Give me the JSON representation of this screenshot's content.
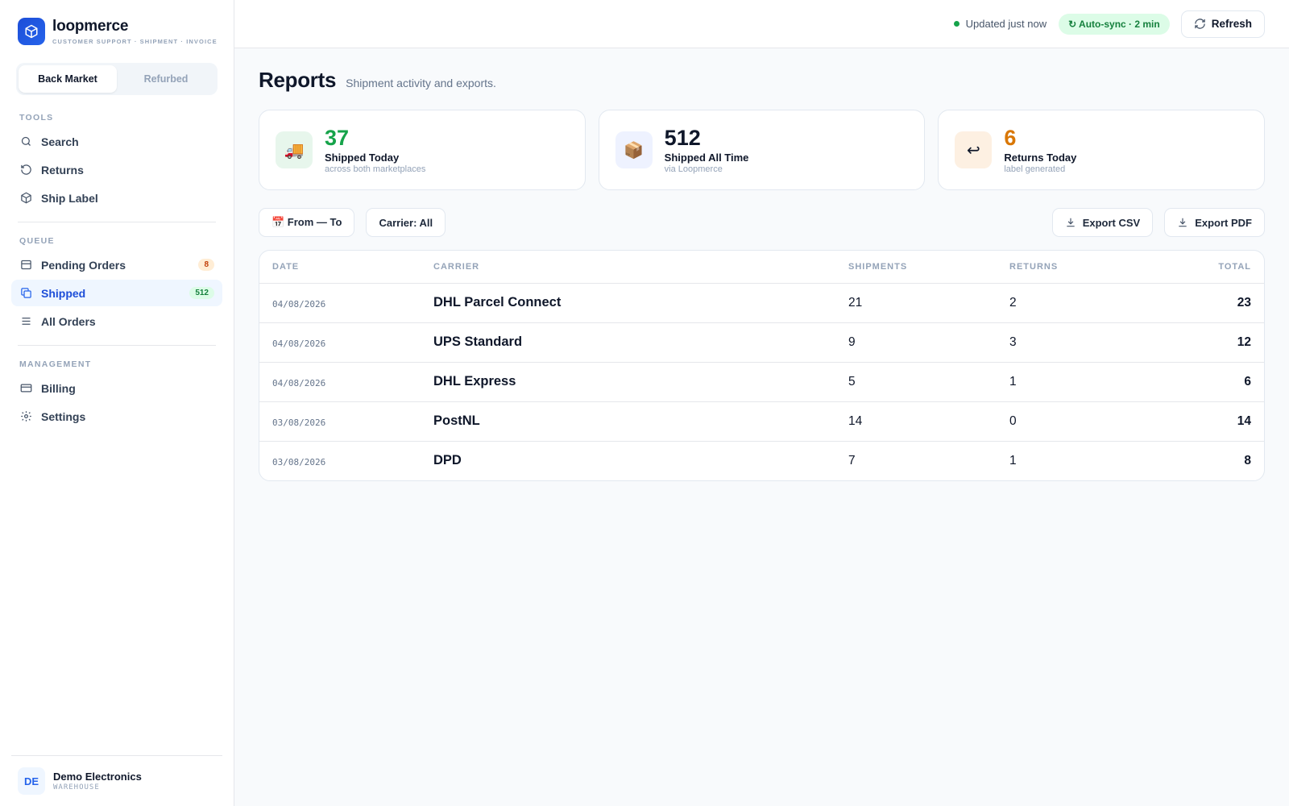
{
  "brand": {
    "name": "loopmerce",
    "tagline": "CUSTOMER SUPPORT · SHIPMENT · INVOICE"
  },
  "store_switch": {
    "options": [
      "Back Market",
      "Refurbed"
    ],
    "selected": "Back Market"
  },
  "sidebar": {
    "tools_label": "TOOLS",
    "tools": [
      {
        "label": "Search",
        "icon": "search-icon"
      },
      {
        "label": "Returns",
        "icon": "undo-icon"
      },
      {
        "label": "Ship Label",
        "icon": "box-icon"
      }
    ],
    "queue_label": "QUEUE",
    "queue": [
      {
        "label": "Pending Orders",
        "icon": "inbox-icon",
        "badge": "8"
      },
      {
        "label": "Shipped",
        "icon": "copy-icon",
        "badge": "512",
        "active": true
      },
      {
        "label": "All Orders",
        "icon": "list-icon"
      }
    ],
    "management_label": "MANAGEMENT",
    "management": [
      {
        "label": "Billing",
        "icon": "credit-card-icon"
      },
      {
        "label": "Settings",
        "icon": "gear-icon"
      }
    ]
  },
  "account": {
    "initials": "DE",
    "name": "Demo Electronics",
    "role": "WAREHOUSE"
  },
  "topbar": {
    "status_text": "Updated just now",
    "sync_label": "↻ Auto-sync · 2 min",
    "refresh_label": "Refresh",
    "colors": {
      "online": "#16a34a",
      "sync_bg": "#dcfce7"
    }
  },
  "page": {
    "title": "Reports",
    "subtitle": "Shipment activity and exports."
  },
  "stats": [
    {
      "icon": "🚚",
      "value": "37",
      "label": "Shipped Today",
      "sub": "across both marketplaces",
      "accent": "#16a34a"
    },
    {
      "icon": "📦",
      "value": "512",
      "label": "Shipped All Time",
      "sub": "via Loopmerce",
      "accent": "#0f172a"
    },
    {
      "icon": "↩",
      "value": "6",
      "label": "Returns Today",
      "sub": "label generated",
      "accent": "#d97706"
    }
  ],
  "filters": {
    "date_range": "📅 From — To",
    "carrier": "Carrier: All",
    "export_csv": "Export CSV",
    "export_pdf": "Export PDF"
  },
  "table": {
    "headers": [
      "DATE",
      "CARRIER",
      "SHIPMENTS",
      "RETURNS",
      "TOTAL"
    ],
    "rows": [
      {
        "date": "04/08/2026",
        "carrier": "DHL Parcel Connect",
        "shipments": "21",
        "returns": "2",
        "total": "23"
      },
      {
        "date": "04/08/2026",
        "carrier": "UPS Standard",
        "shipments": "9",
        "returns": "3",
        "total": "12"
      },
      {
        "date": "04/08/2026",
        "carrier": "DHL Express",
        "shipments": "5",
        "returns": "1",
        "total": "6"
      },
      {
        "date": "03/08/2026",
        "carrier": "PostNL",
        "shipments": "14",
        "returns": "0",
        "total": "14"
      },
      {
        "date": "03/08/2026",
        "carrier": "DPD",
        "shipments": "7",
        "returns": "1",
        "total": "8"
      }
    ]
  }
}
